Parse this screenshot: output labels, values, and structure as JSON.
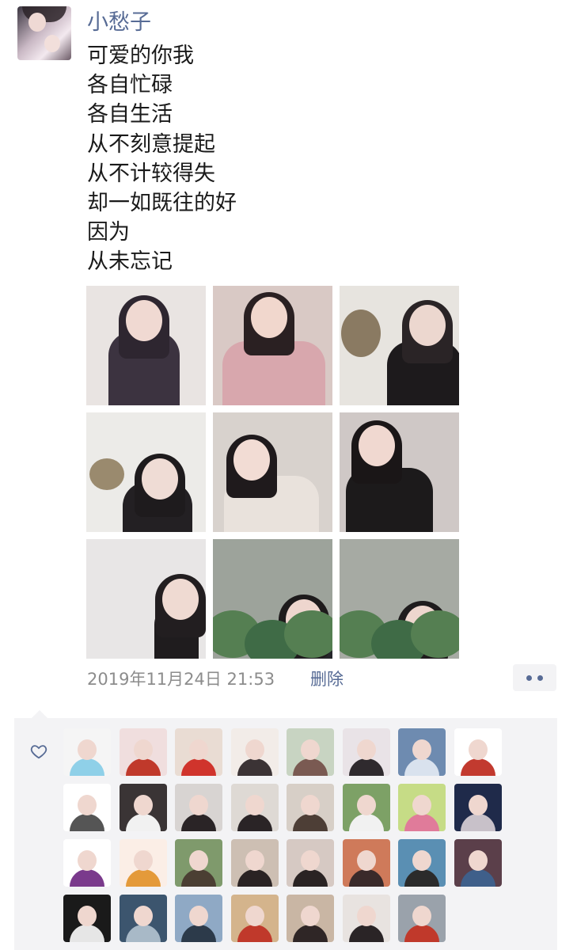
{
  "post": {
    "author": "小愁子",
    "lines": [
      "可爱的你我",
      "各自忙碌",
      "各自生活",
      "从不刻意提起",
      "从不计较得失",
      "却一如既往的好",
      "因为",
      "从未忘记"
    ],
    "timestamp": "2019年11月24日 21:53",
    "delete_label": "删除"
  },
  "photos": [
    {
      "bg": "#e9e4e2",
      "accent": "#2e2630",
      "skin": "#f0d9d2",
      "cloth": "#3c3340"
    },
    {
      "bg": "#d9c9c5",
      "accent": "#2a2022",
      "skin": "#f1d7cd",
      "cloth": "#d8a7ad"
    },
    {
      "bg": "#e7e4df",
      "accent": "#2a2426",
      "skin": "#ecd7cf",
      "cloth": "#1d1a1c"
    },
    {
      "bg": "#ecebe8",
      "accent": "#1e1b1d",
      "skin": "#efdcd5",
      "cloth": "#232023"
    },
    {
      "bg": "#d8d2cd",
      "accent": "#1f1a1c",
      "skin": "#f2dcd4",
      "cloth": "#e9e2dc"
    },
    {
      "bg": "#cfc8c6",
      "accent": "#1a1617",
      "skin": "#f0d8d0",
      "cloth": "#1c1a1b"
    },
    {
      "bg": "#e8e6e6",
      "accent": "#221e20",
      "skin": "#efdad2",
      "cloth": "#1f1c1e"
    },
    {
      "bg": "#9da39b",
      "accent": "#1e1b1c",
      "skin": "#eed6ce",
      "cloth": "#25262a"
    },
    {
      "bg": "#a6aaa3",
      "accent": "#1f1c1d",
      "skin": "#eed6ce",
      "cloth": "#2a2b2e"
    }
  ],
  "likes": {
    "avatars": [
      {
        "bg": "#f5f5f5",
        "fg": "#8fd0e8"
      },
      {
        "bg": "#f0dede",
        "fg": "#c0392b"
      },
      {
        "bg": "#e9dcd3",
        "fg": "#d0342c"
      },
      {
        "bg": "#f2ece8",
        "fg": "#3b3335"
      },
      {
        "bg": "#c8d4c2",
        "fg": "#7a5a52"
      },
      {
        "bg": "#e9e3e7",
        "fg": "#2f2a2e"
      },
      {
        "bg": "#6e8bb0",
        "fg": "#d9e2ee"
      },
      {
        "bg": "#ffffff",
        "fg": "#c23a2f"
      },
      {
        "bg": "#ffffff",
        "fg": "#555555"
      },
      {
        "bg": "#3a3435",
        "fg": "#f1f1f1"
      },
      {
        "bg": "#d8d4d2",
        "fg": "#2a2426"
      },
      {
        "bg": "#ded9d4",
        "fg": "#2a2426"
      },
      {
        "bg": "#d7cfc7",
        "fg": "#4d3e36"
      },
      {
        "bg": "#7da166",
        "fg": "#f1f1f1"
      },
      {
        "bg": "#c6dc86",
        "fg": "#e07b9a"
      },
      {
        "bg": "#1f2a4a",
        "fg": "#c8c1c9"
      },
      {
        "bg": "#ffffff",
        "fg": "#7a3a8c"
      },
      {
        "bg": "#fbeee6",
        "fg": "#e49a3a"
      },
      {
        "bg": "#7f9a6c",
        "fg": "#4b3f33"
      },
      {
        "bg": "#cdbfb3",
        "fg": "#2a2323"
      },
      {
        "bg": "#d6c9c3",
        "fg": "#2a2323"
      },
      {
        "bg": "#cf7a5a",
        "fg": "#3a2a2a"
      },
      {
        "bg": "#5a8fb3",
        "fg": "#2b2b2b"
      },
      {
        "bg": "#5b3f4a",
        "fg": "#3f5f8a"
      },
      {
        "bg": "#1a1a1a",
        "fg": "#e6e6e6"
      },
      {
        "bg": "#3c556e",
        "fg": "#a8b9c7"
      },
      {
        "bg": "#8fa9c5",
        "fg": "#2c3a4a"
      },
      {
        "bg": "#d4b48c",
        "fg": "#c0392b"
      },
      {
        "bg": "#c9b6a4",
        "fg": "#2f2626"
      },
      {
        "bg": "#e8e3e0",
        "fg": "#2a2426"
      },
      {
        "bg": "#9aa2ab",
        "fg": "#c0392b"
      }
    ]
  },
  "icons": {
    "heart": "heart-outline-icon",
    "more": "more-dots-icon"
  },
  "colors": {
    "link": "#576b95",
    "meta": "#8c8c8c",
    "likes_bg": "#f3f3f5"
  }
}
